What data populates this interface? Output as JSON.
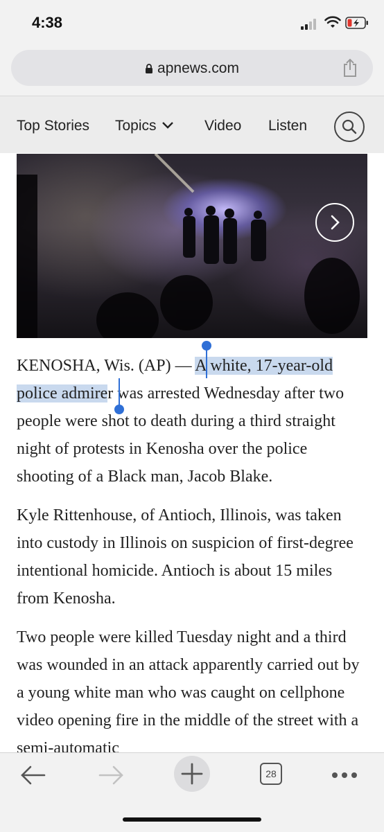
{
  "status_bar": {
    "time": "4:38"
  },
  "browser": {
    "url": "apnews.com",
    "tabs_count": "28"
  },
  "nav": {
    "items": [
      {
        "label": "Top Stories"
      },
      {
        "label": "Topics"
      },
      {
        "label": "Video"
      },
      {
        "label": "Listen"
      }
    ]
  },
  "article": {
    "p1_lead": "KENOSHA, Wis. (AP) — ",
    "p1_selected_1": "A white, 17-year-old",
    "p1_selected_2": "police admire",
    "p1_selected_3": "r",
    "p1_rest": " was arrested Wednesday after two people were shot to death during a third straight night of protests in Kenosha over the police shooting of a Black man, Jacob Blake.",
    "p2": "Kyle Rittenhouse, of Antioch, Illinois, was taken into custody in Illinois on suspicion of first-degree intentional homicide. Antioch is about 15 miles from Kenosha.",
    "p3": "Two people were killed Tuesday night and a third was wounded in an attack apparently carried out by a young white man who was caught on cellphone video opening fire in the middle of the street with a semi-automatic"
  },
  "colors": {
    "selection": "#c9d9ee",
    "cursor": "#2f6fd6"
  },
  "icons": {
    "lock": "lock-icon",
    "share": "share-icon",
    "search": "search-icon",
    "next": "chevron-right-icon",
    "back": "arrow-left-icon",
    "forward": "arrow-right-icon",
    "new_tab": "plus-icon",
    "more": "more-dots-icon"
  }
}
